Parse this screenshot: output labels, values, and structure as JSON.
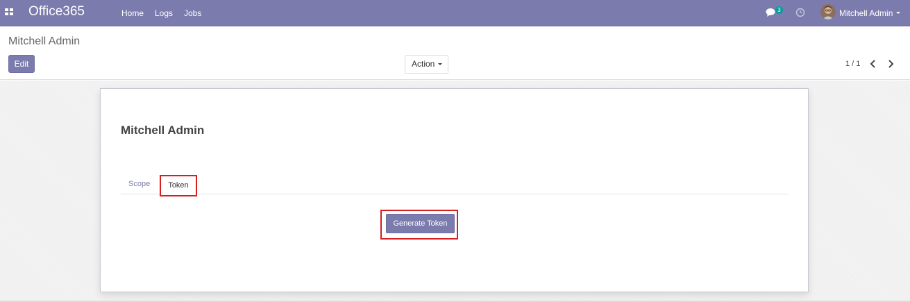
{
  "navbar": {
    "apps_icon": "grid-apps-icon",
    "brand": "Office365",
    "menu": [
      "Home",
      "Logs",
      "Jobs"
    ],
    "chat_icon": "chat-bubble-icon",
    "chat_badge": "3",
    "activity_icon": "clock-icon",
    "user_name": "Mitchell Admin",
    "accent_color": "#7c7bad"
  },
  "control_panel": {
    "breadcrumb": "Mitchell Admin",
    "edit_label": "Edit",
    "action_label": "Action",
    "pager": "1 / 1",
    "prev_icon": "chevron-left-icon",
    "next_icon": "chevron-right-icon"
  },
  "sheet": {
    "title": "Mitchell Admin",
    "tabs": [
      "Scope",
      "Token"
    ],
    "active_tab": "Token",
    "generate_button": "Generate Token",
    "highlight_color": "#d62020"
  }
}
